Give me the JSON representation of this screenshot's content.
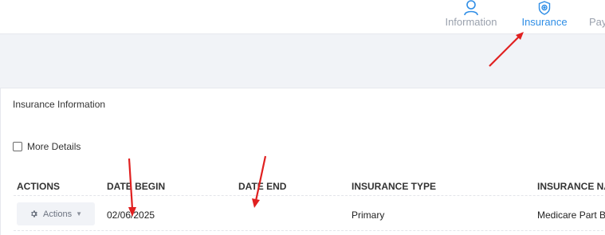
{
  "nav": {
    "tabs": [
      {
        "label": "Information",
        "icon": "user-icon",
        "active": false
      },
      {
        "label": "Insurance",
        "icon": "shield-plus-icon",
        "active": true
      },
      {
        "label": "Pay",
        "icon": "payments-icon",
        "active": false
      }
    ],
    "active_color": "#2f8ee6",
    "inactive_color": "#9aa1ad"
  },
  "card": {
    "title": "Insurance Information",
    "more_details_label": "More Details",
    "more_details_checked": false
  },
  "table": {
    "headers": [
      "ACTIONS",
      "DATE BEGIN",
      "DATE END",
      "INSURANCE TYPE",
      "INSURANCE NA"
    ],
    "rows": [
      {
        "actions_label": "Actions",
        "date_begin": "02/06/2025",
        "date_end": "",
        "insurance_type": "Primary",
        "insurance_name": "Medicare Part B"
      }
    ]
  },
  "annotation_color": "#e02020"
}
